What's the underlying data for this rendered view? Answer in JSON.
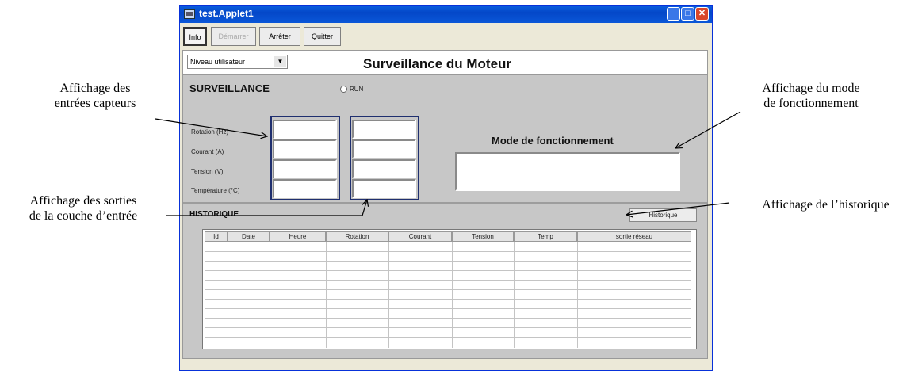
{
  "window": {
    "title": "test.Applet1",
    "min_icon": "minimize-icon",
    "max_icon": "maximize-icon",
    "close_icon": "close-icon"
  },
  "toolbar": {
    "info": "Info",
    "start": "Démarrer",
    "stop": "Arrêter",
    "quit": "Quitter"
  },
  "header": {
    "level_select": "Niveau utilisateur",
    "title": "Surveillance du Moteur"
  },
  "surveillance": {
    "title": "SURVEILLANCE",
    "run_label": "RUN",
    "labels": [
      "Rotation (Hz)",
      "Courant (A)",
      "Tension (V)",
      "Température (°C)"
    ],
    "inputs": [
      "",
      "",
      "",
      ""
    ],
    "outputs": [
      "",
      "",
      "",
      ""
    ]
  },
  "mode": {
    "title": "Mode de fonctionnement",
    "value": ""
  },
  "history": {
    "title": "HISTORIQUE",
    "button": "Historique",
    "columns": [
      "Id",
      "Date",
      "Heure",
      "Rotation",
      "Courant",
      "Tension",
      "Temp",
      "sortie réseau"
    ],
    "rows": []
  },
  "annotations": {
    "sensors": "Affichage des\nentrées capteurs",
    "outputs": "Affichage des sorties\nde la couche d’entrée",
    "mode": "Affichage du mode\nde fonctionnement",
    "history": "Affichage de l’historique"
  }
}
